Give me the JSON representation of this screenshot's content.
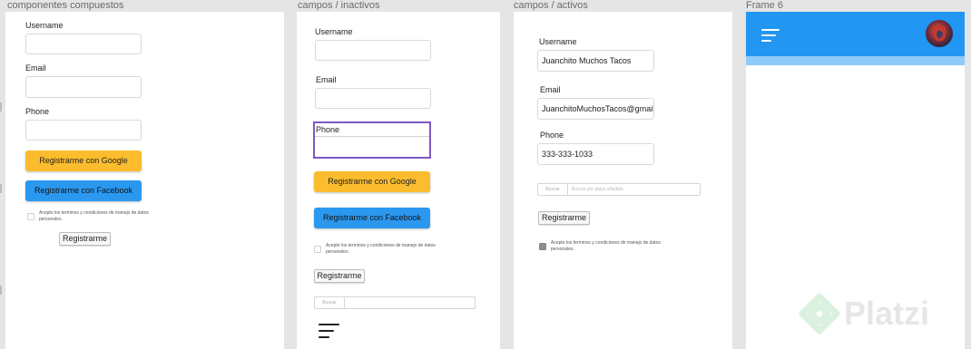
{
  "frames": {
    "compuestos": {
      "label": "componentes compuestos"
    },
    "inactivos": {
      "label": "campos / inactivos"
    },
    "activos": {
      "label": "campos / activos"
    },
    "frame6": {
      "label": "Frame 6"
    }
  },
  "form_compuestos": {
    "username_label": "Username",
    "email_label": "Email",
    "phone_label": "Phone",
    "google_button": "Registrarme con Google",
    "facebook_button": "Registrarme con Facebook",
    "terms_text": "Acepto los terminos y condiciones de manejo de datos personales.",
    "register_button": "Registrarme"
  },
  "form_inactivos": {
    "username_label": "Username",
    "email_label": "Email",
    "phone_label": "Phone",
    "google_button": "Registrarme con Google",
    "facebook_button": "Registrarme con Facebook",
    "terms_text": "Acepto los terminos y condiciones de manejo de datos personales.",
    "register_button": "Registrarme",
    "search_button": "Buscar",
    "search_placeholder": ""
  },
  "form_activos": {
    "username_label": "Username",
    "username_value": "Juanchito Muchos Tacos",
    "email_label": "Email",
    "email_value": "JuanchitoMuchosTacos@gmail.com",
    "phone_label": "Phone",
    "phone_value": "333-333-1033",
    "search_button": "Buscar",
    "search_placeholder": "Buscar por playa añadido",
    "register_button": "Registrarme",
    "terms_text": "Acepto los terminos y condiciones de manejo de datos personales.",
    "terms_checked": true
  },
  "frame6": {
    "header_color": "#2196f3",
    "subbar_color": "#90caf9"
  },
  "watermark": {
    "text": "Platzi"
  },
  "colors": {
    "google": "#fbbd2d",
    "facebook": "#2b98f0",
    "focus_border": "#7e57c2",
    "canvas": "#e5e5e5"
  }
}
